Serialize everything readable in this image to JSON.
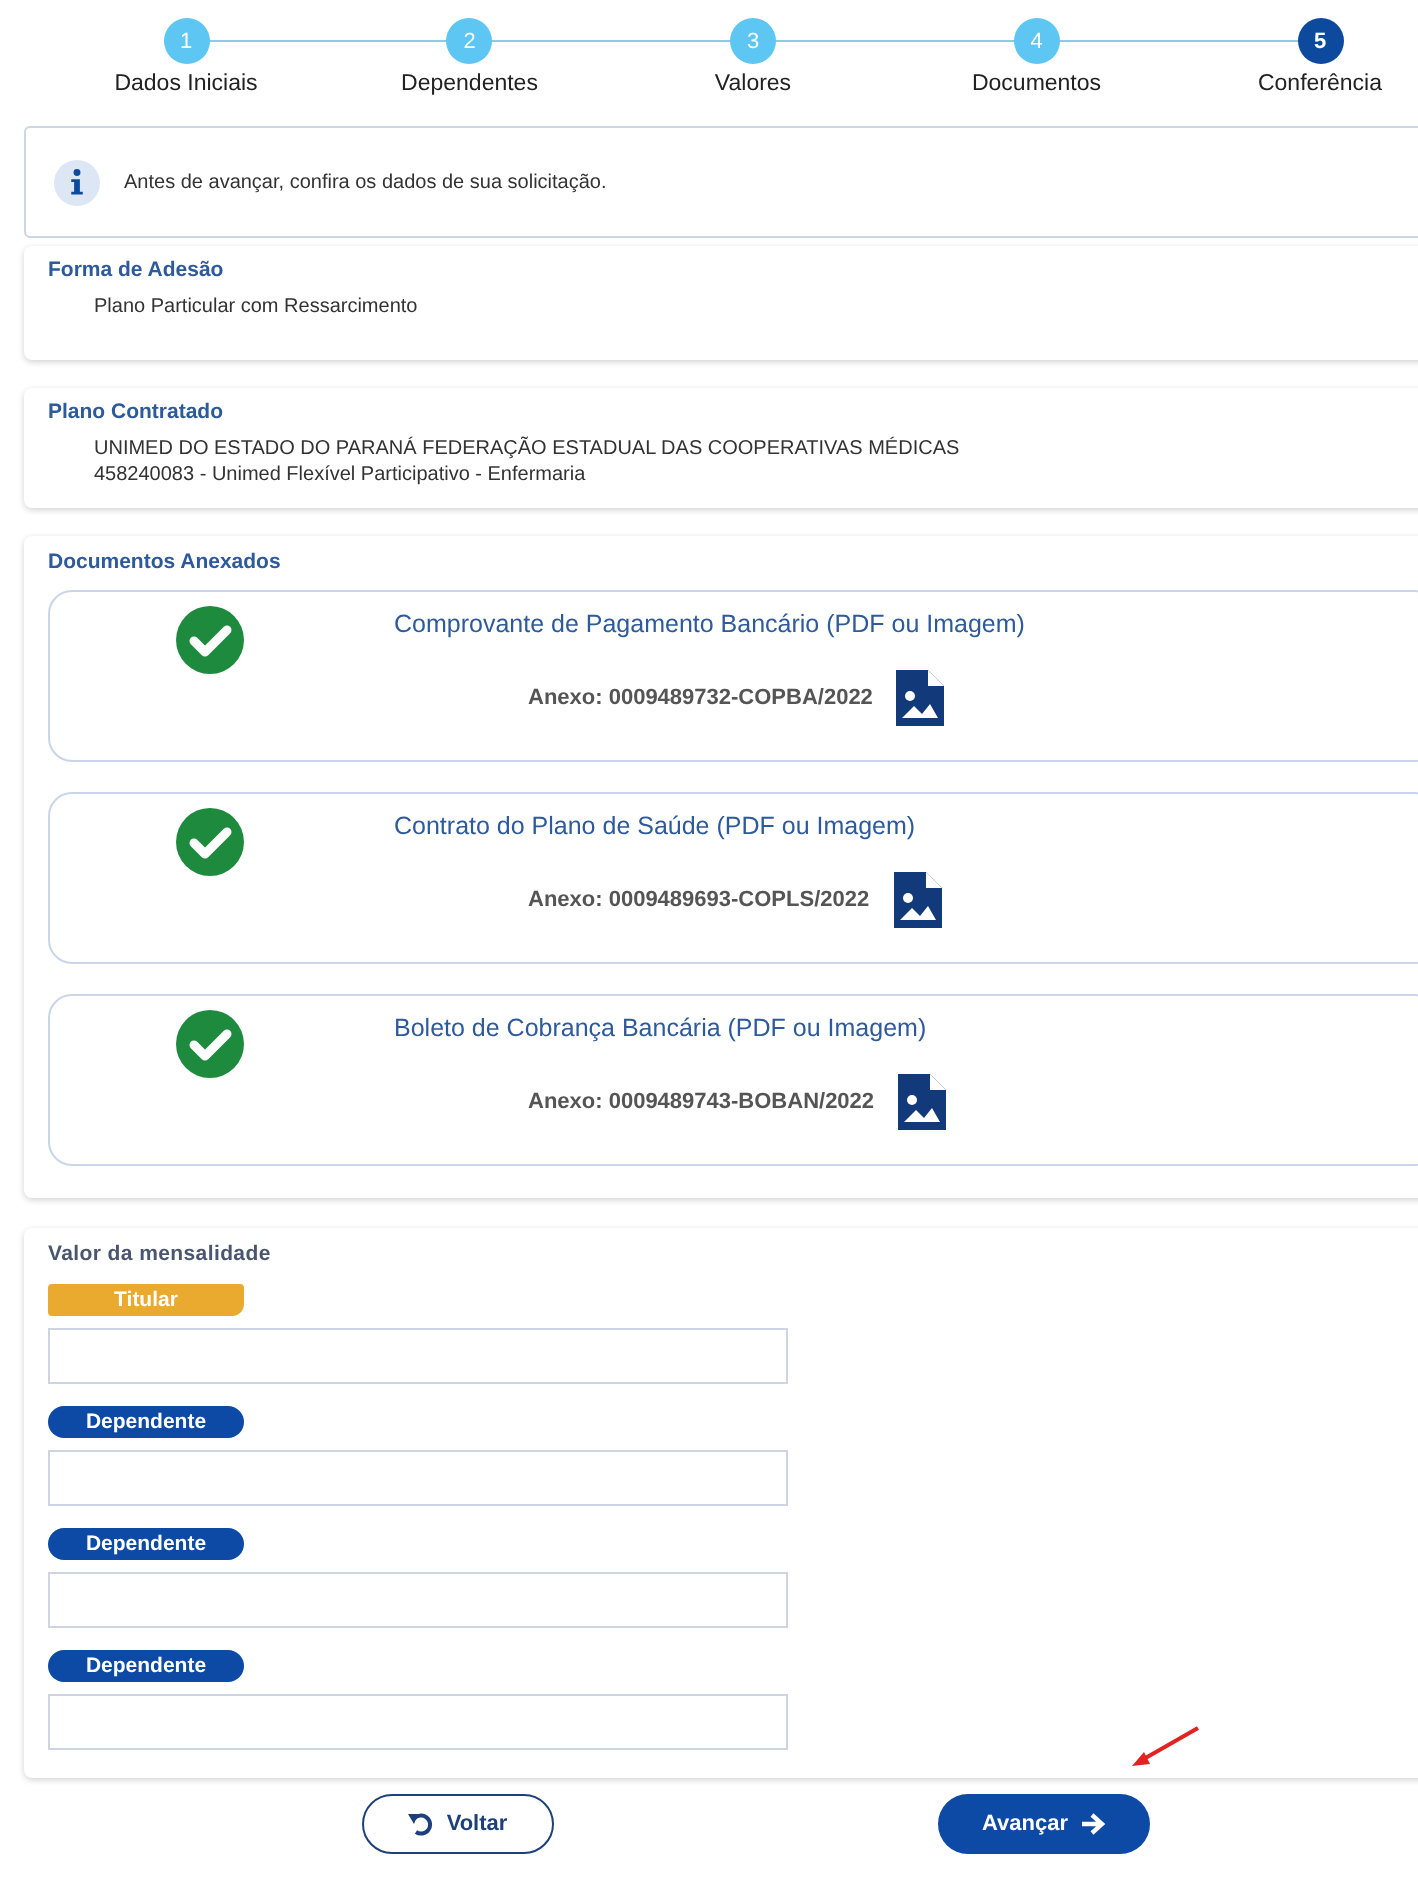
{
  "steps": [
    {
      "number": "1",
      "label": "Dados Iniciais",
      "selected": false
    },
    {
      "number": "2",
      "label": "Dependentes",
      "selected": false
    },
    {
      "number": "3",
      "label": "Valores",
      "selected": false
    },
    {
      "number": "4",
      "label": "Documentos",
      "selected": false
    },
    {
      "number": "5",
      "label": "Conferência",
      "selected": true
    }
  ],
  "notice": "Antes de avançar, confira os dados de sua solicitação.",
  "forma_adesao": {
    "title": "Forma de Adesão",
    "lines": [
      "Plano Particular com Ressarcimento"
    ]
  },
  "plano_contratado": {
    "title": "Plano Contratado",
    "lines": [
      "UNIMED DO ESTADO DO PARANÁ FEDERAÇÃO ESTADUAL DAS COOPERATIVAS MÉDICAS",
      "458240083 - Unimed Flexível Participativo - Enfermaria"
    ]
  },
  "documentos": {
    "title": "Documentos Anexados",
    "items": [
      {
        "name": "Comprovante de Pagamento Bancário (PDF ou Imagem)",
        "attachment": "Anexo: 0009489732-COPBA/2022"
      },
      {
        "name": "Contrato do Plano de Saúde (PDF ou Imagem)",
        "attachment": "Anexo: 0009489693-COPLS/2022"
      },
      {
        "name": "Boleto de Cobrança Bancária (PDF ou Imagem)",
        "attachment": "Anexo: 0009489743-BOBAN/2022"
      }
    ]
  },
  "mensalidade": {
    "title": "Valor da mensalidade",
    "entries": [
      {
        "kind": "titular",
        "badge": "Titular"
      },
      {
        "kind": "dependente",
        "badge": "Dependente"
      },
      {
        "kind": "dependente",
        "badge": "Dependente"
      },
      {
        "kind": "dependente",
        "badge": "Dependente"
      }
    ]
  },
  "buttons": {
    "back": "Voltar",
    "next": "Avançar"
  }
}
